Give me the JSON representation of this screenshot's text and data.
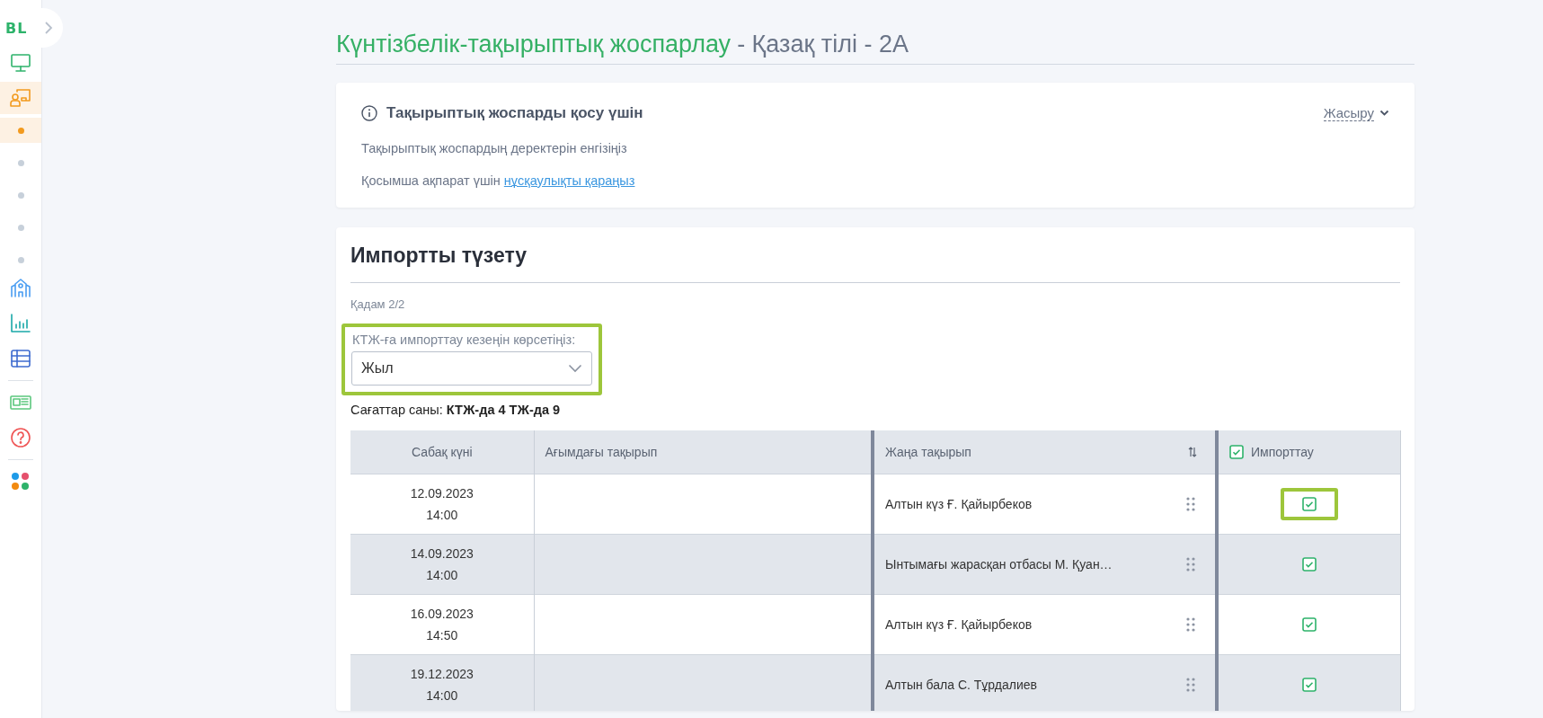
{
  "sidebar": {
    "logo": "BL",
    "items": [
      {
        "selected": false
      },
      {
        "selected": true,
        "children": [
          {
            "selected": true
          },
          {
            "selected": false
          },
          {
            "selected": false
          },
          {
            "selected": false
          },
          {
            "selected": false
          }
        ]
      },
      {
        "selected": false
      },
      {
        "selected": false
      },
      {
        "selected": false
      },
      {
        "selected": false
      },
      {
        "selected": false
      },
      {
        "selected": false
      }
    ]
  },
  "title": {
    "main": "Күнтізбелік-тақырыптық жоспарлау",
    "subtitle": "- Қазақ тілі - 2А"
  },
  "info_card": {
    "heading": "Тақырыптық жоспарды қосу үшін",
    "toggle": "Жасыру",
    "text": "Тақырыптық жоспардың деректерін енгізіңіз",
    "note": "Қосымша ақпарат үшін",
    "link": "нұсқаулықты қараңыз"
  },
  "import_card": {
    "heading": "Импортты түзету",
    "step": "Қадам 2/2",
    "period": {
      "label": "КТЖ-ға импорттау кезеңін көрсетіңіз:",
      "value": "Жыл",
      "highlighted": true
    },
    "hours": "Сағаттар саны: **КТЖ-да 4 ТЖ-да 9**",
    "table": {
      "columns": [
        "Сабақ күні",
        "Ағымдағы тақырып",
        "Жаңа тақырып",
        "Импорттау"
      ],
      "import_all": true,
      "rows": [
        {
          "date": "12.09.2023",
          "time": "14:00",
          "new_topic": "Алтын күз Ғ. Қайырбеков",
          "import": true,
          "highlighted": true
        },
        {
          "date": "14.09.2023",
          "time": "14:00",
          "new_topic": "Ынтымағы жарасқан отбасы М. Қуан…",
          "import": true,
          "highlighted": false
        },
        {
          "date": "16.09.2023",
          "time": "14:50",
          "new_topic": "Алтын күз Ғ. Қайырбеков",
          "import": true,
          "highlighted": false
        },
        {
          "date": "19.12.2023",
          "time": "14:00",
          "new_topic": "Алтын бала С. Тұрдалиев",
          "import": true,
          "highlighted": false
        }
      ]
    }
  }
}
